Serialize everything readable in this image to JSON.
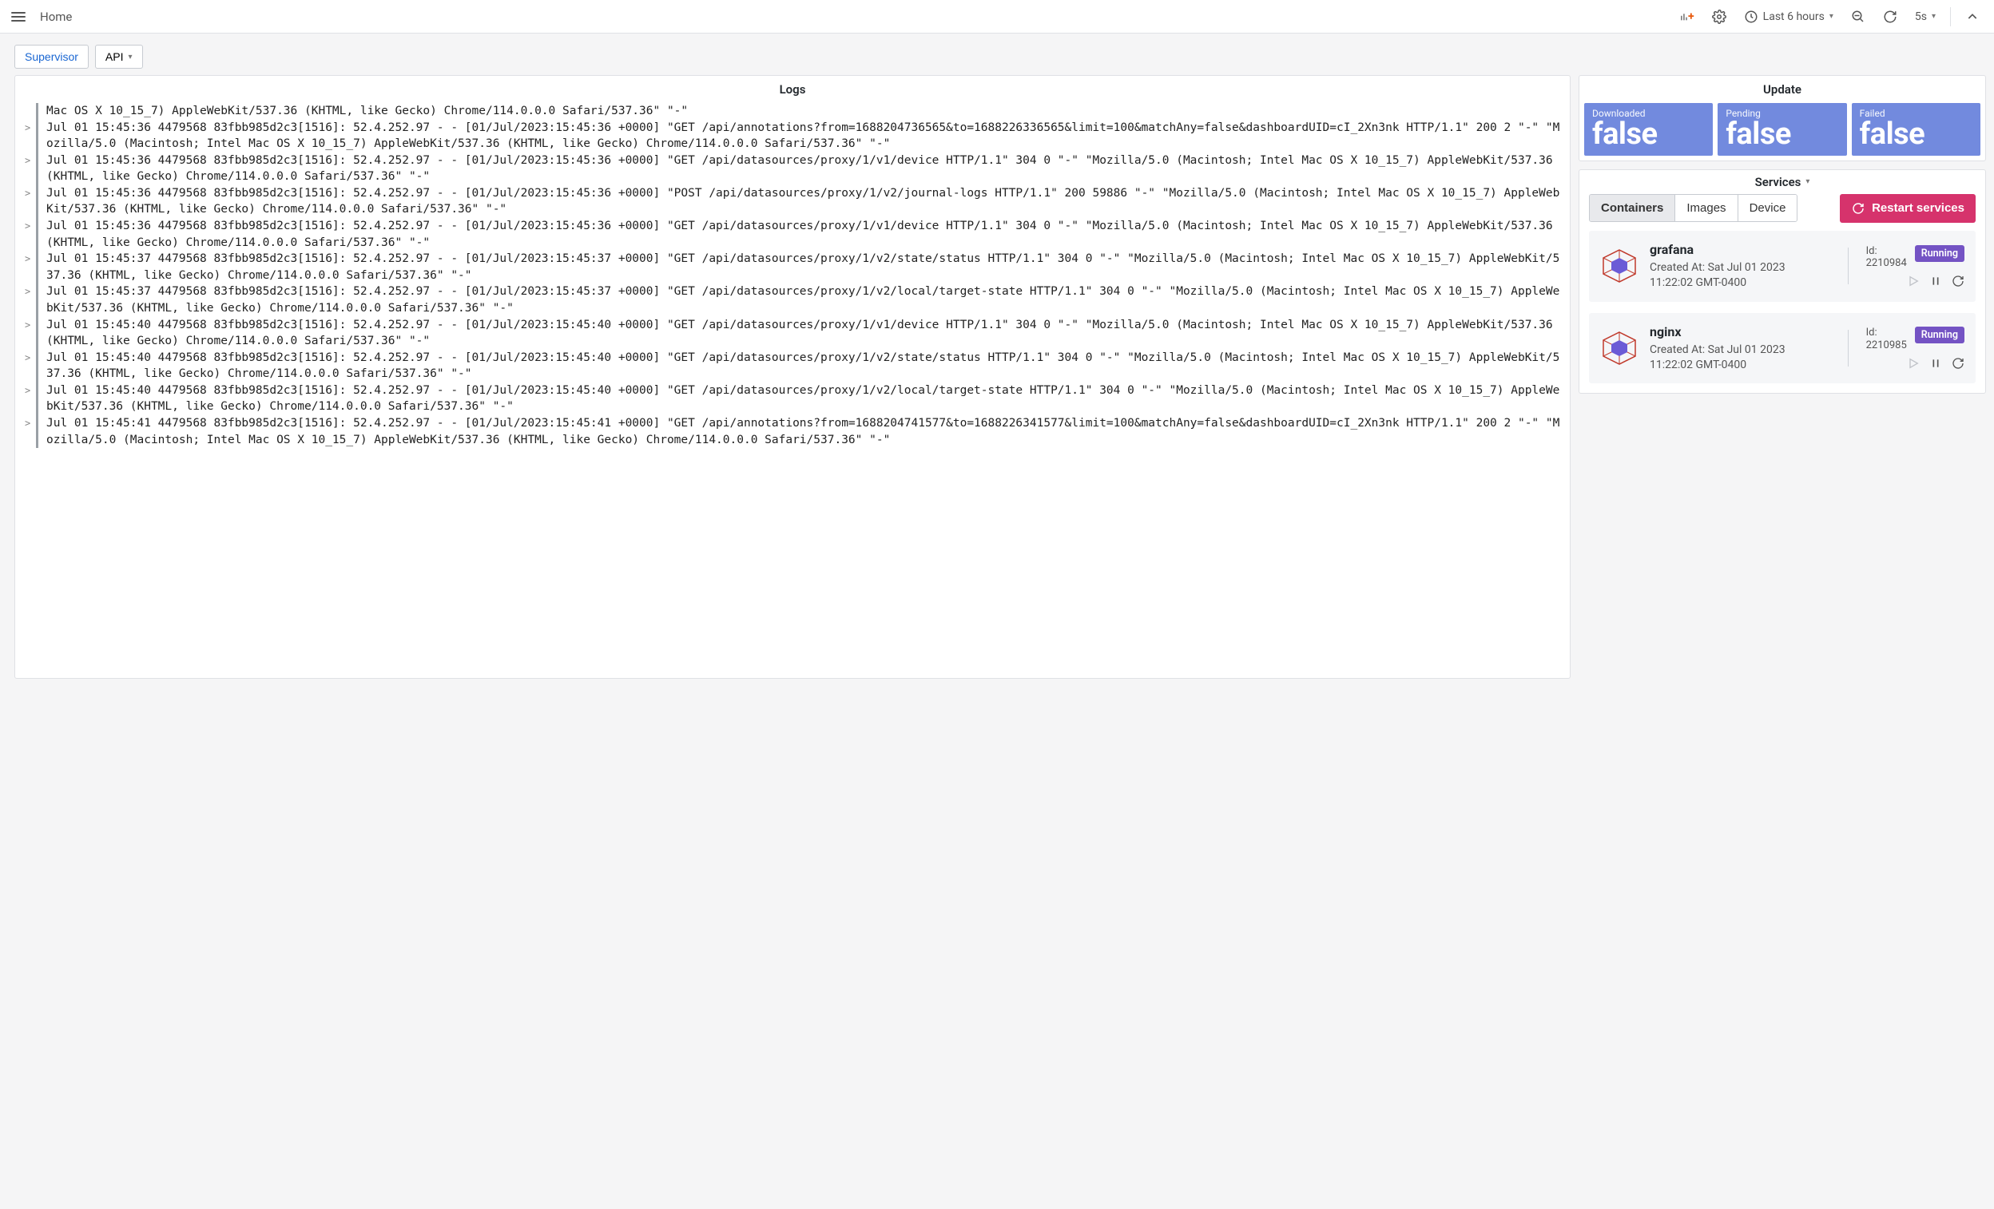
{
  "header": {
    "breadcrumb": "Home",
    "time_range": "Last 6 hours",
    "refresh_interval": "5s"
  },
  "tabs": {
    "supervisor": "Supervisor",
    "api": "API"
  },
  "logs": {
    "title": "Logs",
    "entries": [
      "Mac OS X 10_15_7) AppleWebKit/537.36 (KHTML, like Gecko) Chrome/114.0.0.0 Safari/537.36\" \"-\"",
      "Jul 01 15:45:36 4479568 83fbb985d2c3[1516]: 52.4.252.97 - - [01/Jul/2023:15:45:36 +0000] \"GET /api/annotations?from=1688204736565&to=1688226336565&limit=100&matchAny=false&dashboardUID=cI_2Xn3nk HTTP/1.1\" 200 2 \"-\" \"Mozilla/5.0 (Macintosh; Intel Mac OS X 10_15_7) AppleWebKit/537.36 (KHTML, like Gecko) Chrome/114.0.0.0 Safari/537.36\" \"-\"",
      "Jul 01 15:45:36 4479568 83fbb985d2c3[1516]: 52.4.252.97 - - [01/Jul/2023:15:45:36 +0000] \"GET /api/datasources/proxy/1/v1/device HTTP/1.1\" 304 0 \"-\" \"Mozilla/5.0 (Macintosh; Intel Mac OS X 10_15_7) AppleWebKit/537.36 (KHTML, like Gecko) Chrome/114.0.0.0 Safari/537.36\" \"-\"",
      "Jul 01 15:45:36 4479568 83fbb985d2c3[1516]: 52.4.252.97 - - [01/Jul/2023:15:45:36 +0000] \"POST /api/datasources/proxy/1/v2/journal-logs HTTP/1.1\" 200 59886 \"-\" \"Mozilla/5.0 (Macintosh; Intel Mac OS X 10_15_7) AppleWebKit/537.36 (KHTML, like Gecko) Chrome/114.0.0.0 Safari/537.36\" \"-\"",
      "Jul 01 15:45:36 4479568 83fbb985d2c3[1516]: 52.4.252.97 - - [01/Jul/2023:15:45:36 +0000] \"GET /api/datasources/proxy/1/v1/device HTTP/1.1\" 304 0 \"-\" \"Mozilla/5.0 (Macintosh; Intel Mac OS X 10_15_7) AppleWebKit/537.36 (KHTML, like Gecko) Chrome/114.0.0.0 Safari/537.36\" \"-\"",
      "Jul 01 15:45:37 4479568 83fbb985d2c3[1516]: 52.4.252.97 - - [01/Jul/2023:15:45:37 +0000] \"GET /api/datasources/proxy/1/v2/state/status HTTP/1.1\" 304 0 \"-\" \"Mozilla/5.0 (Macintosh; Intel Mac OS X 10_15_7) AppleWebKit/537.36 (KHTML, like Gecko) Chrome/114.0.0.0 Safari/537.36\" \"-\"",
      "Jul 01 15:45:37 4479568 83fbb985d2c3[1516]: 52.4.252.97 - - [01/Jul/2023:15:45:37 +0000] \"GET /api/datasources/proxy/1/v2/local/target-state HTTP/1.1\" 304 0 \"-\" \"Mozilla/5.0 (Macintosh; Intel Mac OS X 10_15_7) AppleWebKit/537.36 (KHTML, like Gecko) Chrome/114.0.0.0 Safari/537.36\" \"-\"",
      "Jul 01 15:45:40 4479568 83fbb985d2c3[1516]: 52.4.252.97 - - [01/Jul/2023:15:45:40 +0000] \"GET /api/datasources/proxy/1/v1/device HTTP/1.1\" 304 0 \"-\" \"Mozilla/5.0 (Macintosh; Intel Mac OS X 10_15_7) AppleWebKit/537.36 (KHTML, like Gecko) Chrome/114.0.0.0 Safari/537.36\" \"-\"",
      "Jul 01 15:45:40 4479568 83fbb985d2c3[1516]: 52.4.252.97 - - [01/Jul/2023:15:45:40 +0000] \"GET /api/datasources/proxy/1/v2/state/status HTTP/1.1\" 304 0 \"-\" \"Mozilla/5.0 (Macintosh; Intel Mac OS X 10_15_7) AppleWebKit/537.36 (KHTML, like Gecko) Chrome/114.0.0.0 Safari/537.36\" \"-\"",
      "Jul 01 15:45:40 4479568 83fbb985d2c3[1516]: 52.4.252.97 - - [01/Jul/2023:15:45:40 +0000] \"GET /api/datasources/proxy/1/v2/local/target-state HTTP/1.1\" 304 0 \"-\" \"Mozilla/5.0 (Macintosh; Intel Mac OS X 10_15_7) AppleWebKit/537.36 (KHTML, like Gecko) Chrome/114.0.0.0 Safari/537.36\" \"-\"",
      "Jul 01 15:45:41 4479568 83fbb985d2c3[1516]: 52.4.252.97 - - [01/Jul/2023:15:45:41 +0000] \"GET /api/annotations?from=1688204741577&to=1688226341577&limit=100&matchAny=false&dashboardUID=cI_2Xn3nk HTTP/1.1\" 200 2 \"-\" \"Mozilla/5.0 (Macintosh; Intel Mac OS X 10_15_7) AppleWebKit/537.36 (KHTML, like Gecko) Chrome/114.0.0.0 Safari/537.36\" \"-\""
    ]
  },
  "update": {
    "title": "Update",
    "cards": [
      {
        "label": "Downloaded",
        "value": "false"
      },
      {
        "label": "Pending",
        "value": "false"
      },
      {
        "label": "Failed",
        "value": "false"
      }
    ]
  },
  "services": {
    "title": "Services",
    "tabs": {
      "containers": "Containers",
      "images": "Images",
      "device": "Device"
    },
    "restart_label": "Restart services",
    "id_label": "Id:",
    "created_prefix": "Created At: ",
    "items": [
      {
        "name": "grafana",
        "created": "Sat Jul 01 2023 11:22:02 GMT-0400",
        "id": "2210984",
        "status": "Running"
      },
      {
        "name": "nginx",
        "created": "Sat Jul 01 2023 11:22:02 GMT-0400",
        "id": "2210985",
        "status": "Running"
      }
    ]
  }
}
